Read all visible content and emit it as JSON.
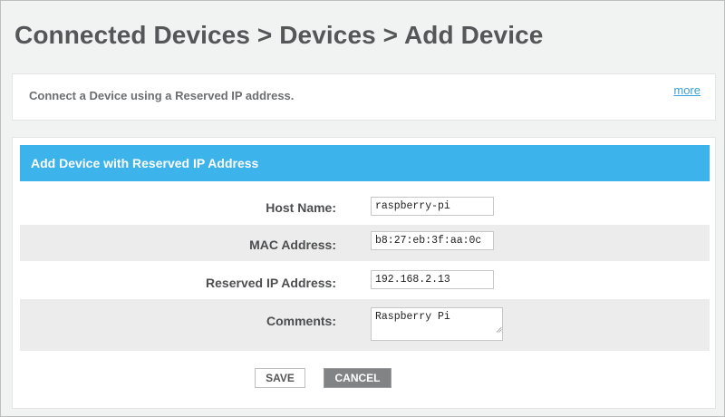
{
  "header": {
    "breadcrumb": "Connected Devices > Devices > Add Device"
  },
  "info": {
    "text": "Connect a Device using a Reserved IP address.",
    "more_link": "more"
  },
  "form": {
    "title": "Add Device with Reserved IP Address",
    "fields": {
      "host_name": {
        "label": "Host Name:",
        "value": "raspberry-pi"
      },
      "mac_address": {
        "label": "MAC Address:",
        "value": "b8:27:eb:3f:aa:0c"
      },
      "reserved_ip": {
        "label": "Reserved IP Address:",
        "value": "192.168.2.13"
      },
      "comments": {
        "label": "Comments:",
        "value": "Raspberry Pi"
      }
    },
    "buttons": {
      "save": "SAVE",
      "cancel": "CANCEL"
    }
  },
  "colors": {
    "header_bar": "#3db3eb",
    "link": "#3a9fd6",
    "cancel_button": "#818385",
    "shaded_row": "#ececec"
  }
}
